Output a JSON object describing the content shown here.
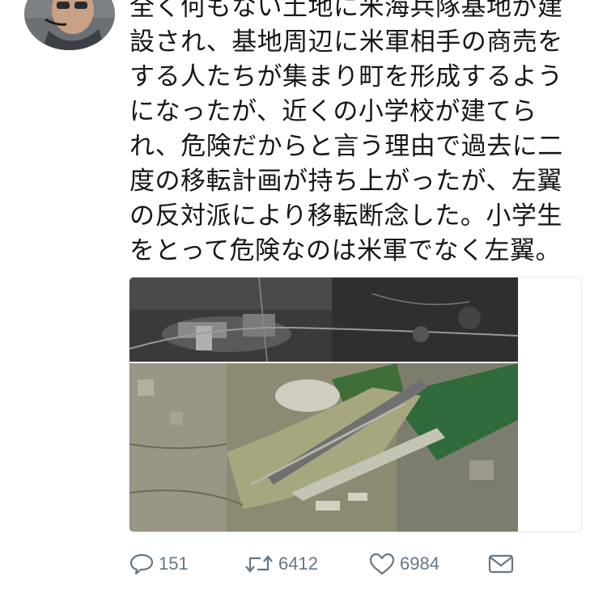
{
  "tweet": {
    "lines": [
      "全く何もない土地に米海兵隊基地が建",
      "設され、基地周辺に米軍相手の商売を",
      "する人たちが集まり町を形成するよう",
      "になったが、近くの小学校が建てら",
      "れ、危険だからと言う理由で過去に二",
      "度の移転計画が持ち上がったが、左翼",
      "の反対派により移転断念した。小学生",
      "をとって危険なのは米軍でなく左翼。"
    ]
  },
  "actions": {
    "reply_count": "151",
    "retweet_count": "6412",
    "like_count": "6984"
  },
  "colors": {
    "text": "#14171a",
    "action_gray": "#657786",
    "card_border": "#e1e8ed"
  },
  "icons": [
    "reply-icon",
    "retweet-icon",
    "like-icon",
    "direct-message-icon"
  ]
}
